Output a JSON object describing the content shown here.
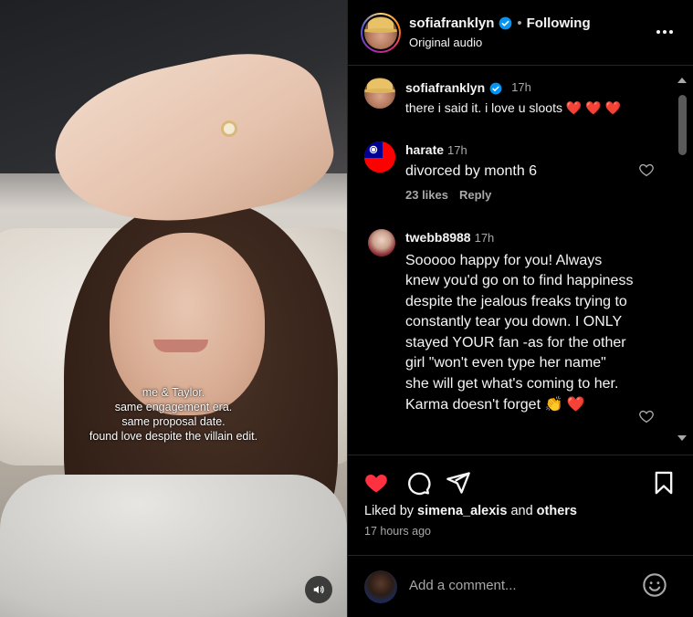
{
  "media": {
    "caption_lines": [
      "me & Taylor.",
      "same engagement era.",
      "same proposal date.",
      "found love despite the villain edit."
    ],
    "mute_icon": "speaker-icon"
  },
  "header": {
    "username": "sofiafranklyn",
    "separator": "•",
    "follow_status": "Following",
    "audio": "Original audio"
  },
  "comments": [
    {
      "username": "sofiafranklyn",
      "verified": true,
      "time": "17h",
      "text": "there i said it. i love u sloots ❤️ ❤️ ❤️"
    },
    {
      "username": "harate",
      "time": "17h",
      "text": "divorced by month 6",
      "likes": "23 likes",
      "reply": "Reply"
    },
    {
      "username": "twebb8988",
      "time": "17h",
      "text": "Sooooo happy for you! Always knew you'd go on to find happiness despite the jealous freaks trying to constantly tear you down. I ONLY stayed YOUR fan -as for the other girl \"won't even type her name\" she will get what's coming to her. Karma doesn't forget 👏 ❤️"
    }
  ],
  "actions": {
    "liked_prefix": "Liked by",
    "liked_user": "simena_alexis",
    "liked_and": "and",
    "liked_others": "others",
    "time_ago": "17 hours ago"
  },
  "add_comment": {
    "placeholder": "Add a comment..."
  },
  "colors": {
    "like_red": "#ff3040",
    "verified_blue": "#0095f6",
    "muted_text": "#a8a8a8"
  }
}
